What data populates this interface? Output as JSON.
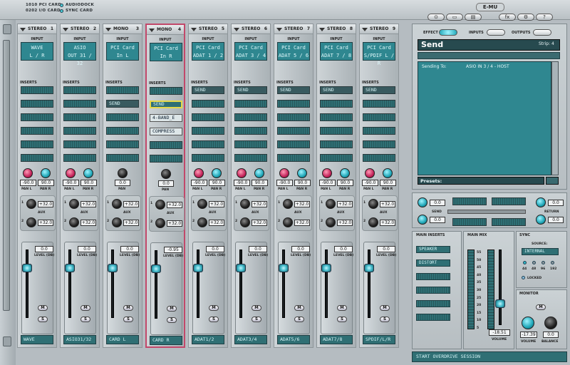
{
  "status": {
    "card1": "1010 PCI CARD",
    "card2": "0202 I/O CARD",
    "dock": "AUDIODOCK",
    "sync": "SYNC CARD"
  },
  "brand": "E-MU",
  "strips": [
    {
      "type": "STEREO",
      "num": "1",
      "input_label": "INPUT",
      "input": [
        "WAVE",
        "L / R"
      ],
      "inserts": [
        "",
        "",
        "",
        "",
        "",
        ""
      ],
      "pan": [
        "-90.0",
        "90.0"
      ],
      "pan_labels": [
        "PAN L",
        "PAN R"
      ],
      "aux": [
        "+32.0",
        "+32.0"
      ],
      "level": "0.0",
      "name": "WAVE"
    },
    {
      "type": "STEREO",
      "num": "2",
      "input_label": "INPUT",
      "input": [
        "ASIO",
        "OUT 31 / 32"
      ],
      "inserts": [
        "",
        "",
        "",
        "",
        "",
        ""
      ],
      "pan": [
        "-90.0",
        "90.0"
      ],
      "pan_labels": [
        "PAN L",
        "PAN R"
      ],
      "aux": [
        "+32.0",
        "+32.0"
      ],
      "level": "0.0",
      "name": "ASIO31/32"
    },
    {
      "type": "MONO",
      "num": "3",
      "input_label": "INPUT",
      "input": [
        "PCI Card",
        "In L"
      ],
      "inserts": [
        "",
        "SEND",
        "",
        "",
        "",
        ""
      ],
      "pan": [
        "0.0"
      ],
      "pan_labels": [
        "PAN"
      ],
      "aux": [
        "+32.0",
        "+32.0"
      ],
      "level": "0.0",
      "name": "CARD L"
    },
    {
      "type": "MONO",
      "num": "4",
      "input_label": "INPUT",
      "input": [
        "PCI Card",
        "In R"
      ],
      "inserts": [
        "",
        "SEND",
        "4-BAND_E",
        "COMPRESS",
        "",
        ""
      ],
      "pan": [
        "0.0"
      ],
      "pan_labels": [
        "PAN"
      ],
      "aux": [
        "+32.0",
        "+32.0"
      ],
      "level": "-0.95",
      "name": "CARD R"
    },
    {
      "type": "STEREO",
      "num": "5",
      "input_label": "INPUT",
      "input": [
        "PCI Card",
        "ADAT 1 / 2"
      ],
      "inserts": [
        "SEND",
        "",
        "",
        "",
        "",
        ""
      ],
      "pan": [
        "-90.0",
        "90.0"
      ],
      "pan_labels": [
        "PAN L",
        "PAN R"
      ],
      "aux": [
        "+32.0",
        "+32.0"
      ],
      "level": "0.0",
      "name": "ADAT1/2"
    },
    {
      "type": "STEREO",
      "num": "6",
      "input_label": "INPUT",
      "input": [
        "PCI Card",
        "ADAT 3 / 4"
      ],
      "inserts": [
        "SEND",
        "",
        "",
        "",
        "",
        ""
      ],
      "pan": [
        "-90.0",
        "90.0"
      ],
      "pan_labels": [
        "PAN L",
        "PAN R"
      ],
      "aux": [
        "+32.0",
        "+32.0"
      ],
      "level": "0.0",
      "name": "ADAT3/4"
    },
    {
      "type": "STEREO",
      "num": "7",
      "input_label": "INPUT",
      "input": [
        "PCI Card",
        "ADAT 5 / 6"
      ],
      "inserts": [
        "SEND",
        "",
        "",
        "",
        "",
        ""
      ],
      "pan": [
        "-90.0",
        "90.0"
      ],
      "pan_labels": [
        "PAN L",
        "PAN R"
      ],
      "aux": [
        "+32.0",
        "+32.0"
      ],
      "level": "0.0",
      "name": "ADAT5/6"
    },
    {
      "type": "STEREO",
      "num": "8",
      "input_label": "INPUT",
      "input": [
        "PCI Card",
        "ADAT 7 / 8"
      ],
      "inserts": [
        "SEND",
        "",
        "",
        "",
        "",
        ""
      ],
      "pan": [
        "-90.0",
        "90.0"
      ],
      "pan_labels": [
        "PAN L",
        "PAN R"
      ],
      "aux": [
        "+32.0",
        "+32.0"
      ],
      "level": "0.0",
      "name": "ADAT7/8"
    },
    {
      "type": "STEREO",
      "num": "9",
      "input_label": "INPUT",
      "input": [
        "PCI Card",
        "S/PDIF L / R"
      ],
      "inserts": [
        "SEND",
        "",
        "",
        "",
        "",
        ""
      ],
      "pan": [
        "-90.0",
        "90.0"
      ],
      "pan_labels": [
        "PAN L",
        "PAN R"
      ],
      "aux": [
        "+32.0",
        "+32.0"
      ],
      "level": "0.0",
      "name": "SPDIF/L/R"
    }
  ],
  "strip_labels": {
    "inserts": "INSERTS",
    "aux": "AUX",
    "level": "LEVEL (DB)",
    "mute": "M",
    "solo": "S"
  },
  "right": {
    "tabs": [
      "EFFECT",
      "INPUTS",
      "OUTPUTS"
    ],
    "send_title": "Send",
    "strip_label": "Strip: 4",
    "sending_label": "Sending To:",
    "sending_to": "ASIO IN 3 / 4 - HOST",
    "presets_label": "Presets:",
    "send_values": [
      "0.0",
      "0.0"
    ],
    "send_label": "SEND",
    "return_label": "RETURN",
    "return_values": [
      "0.0",
      "0.0"
    ],
    "main_inserts_label": "MAIN INSERTS",
    "main_inserts": [
      "SPEAKER",
      "DISTORT",
      "",
      "",
      "",
      ""
    ],
    "main_mix_label": "MAIN MIX",
    "meter_scale": [
      "55",
      "50",
      "45",
      "40",
      "35",
      "30",
      "25",
      "20",
      "15",
      "10",
      "5"
    ],
    "volume_value": "-18.51",
    "volume_label": "VOLUME",
    "sync_label": "SYNC",
    "source_label": "SOURCE:",
    "source": "INTERNAL",
    "rates": [
      "44",
      "48",
      "96",
      "192"
    ],
    "locked": "LOCKED",
    "monitor_label": "MONITOR",
    "monitor_m": "M",
    "monitor_volume": "-17.39",
    "monitor_balance": "0.0",
    "monitor_vol_label": "VOLUME",
    "monitor_bal_label": "BALANCE",
    "session": "START OVERDRIVE SESSION"
  },
  "colors": {
    "lcd": "#2f8790",
    "accent": "#c2486a",
    "knob_red": "#c3245b",
    "knob_teal": "#1fa6b7"
  }
}
